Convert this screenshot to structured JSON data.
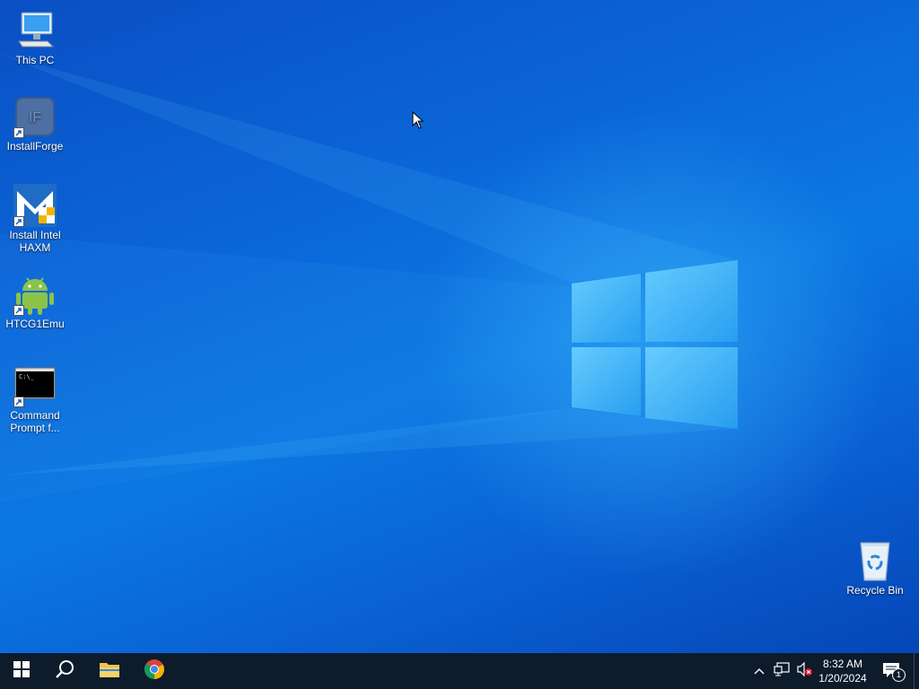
{
  "desktop": {
    "icons": [
      {
        "label": "This PC",
        "icon": "computer-icon"
      },
      {
        "label": "InstallForge",
        "icon": "installforge-icon"
      },
      {
        "label": "Install Intel HAXM",
        "icon": "haxm-icon"
      },
      {
        "label": "HTCG1Emu",
        "icon": "android-icon"
      },
      {
        "label": "Command Prompt f...",
        "icon": "cmd-icon"
      },
      {
        "label": "Recycle Bin",
        "icon": "recycle-bin-icon"
      }
    ]
  },
  "taskbar": {
    "apps": [
      {
        "name": "Start",
        "icon": "windows-start-icon"
      },
      {
        "name": "Search",
        "icon": "search-icon"
      },
      {
        "name": "File Explorer",
        "icon": "folder-icon"
      },
      {
        "name": "Google Chrome",
        "icon": "chrome-icon"
      }
    ],
    "tray": {
      "time": "8:32 AM",
      "date": "1/20/2024",
      "notification_count": "1"
    }
  },
  "colors": {
    "taskbar": "#0d1b2b",
    "desktop_accent": "#0b78e2"
  }
}
